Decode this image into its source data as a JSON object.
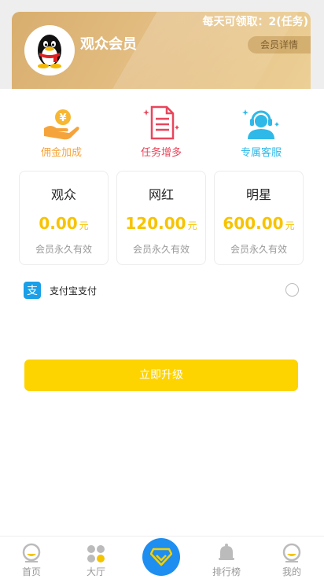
{
  "header": {
    "daily_text": "每天可领取：2(任务)",
    "member_title": "观众会员",
    "detail_button": "会员详情"
  },
  "perks": [
    {
      "label": "佣金加成",
      "icon": "yen-hand-icon",
      "color": "#f5a43b"
    },
    {
      "label": "任务增多",
      "icon": "task-document-icon",
      "color": "#e9465c"
    },
    {
      "label": "专属客服",
      "icon": "customer-service-icon",
      "color": "#2fb9e8"
    }
  ],
  "plans": [
    {
      "name": "观众",
      "price": "0.00",
      "unit": "元",
      "validity": "会员永久有效"
    },
    {
      "name": "网红",
      "price": "120.00",
      "unit": "元",
      "validity": "会员永久有效"
    },
    {
      "name": "明星",
      "price": "600.00",
      "unit": "元",
      "validity": "会员永久有效"
    }
  ],
  "payment": {
    "method_label": "支付宝支付",
    "icon": "alipay-icon",
    "selected": false
  },
  "upgrade_button": "立即升级",
  "tabbar": [
    {
      "label": "首页",
      "icon": "home-icon"
    },
    {
      "label": "大厅",
      "icon": "hall-icon"
    },
    {
      "label": "",
      "icon": "diamond-icon"
    },
    {
      "label": "排行榜",
      "icon": "bell-icon"
    },
    {
      "label": "我的",
      "icon": "profile-icon"
    }
  ],
  "colors": {
    "accent_yellow": "#fdd300",
    "price_yellow": "#f7c300",
    "card_gold": "#e3bd82",
    "tab_blue": "#1e8ef0"
  }
}
